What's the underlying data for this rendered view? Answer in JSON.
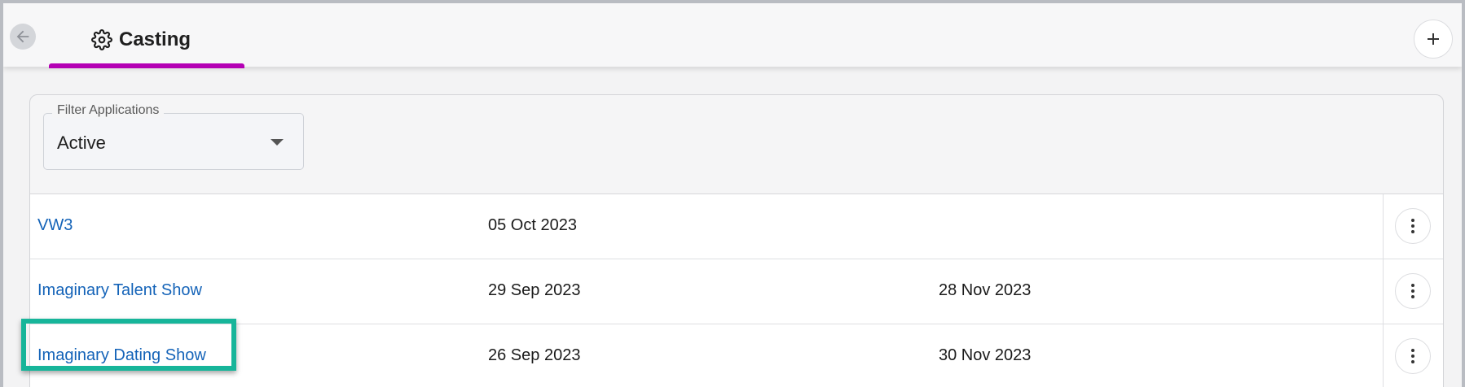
{
  "header": {
    "title": "Casting",
    "back_icon": "arrow-left-icon",
    "settings_icon": "gear-icon",
    "add_icon": "plus-icon",
    "accent_color": "#b400b4"
  },
  "filter": {
    "label": "Filter Applications",
    "value": "Active"
  },
  "rows": [
    {
      "name": "VW3",
      "date1": "05 Oct 2023",
      "date2": ""
    },
    {
      "name": "Imaginary Talent Show",
      "date1": "29 Sep 2023",
      "date2": "28 Nov 2023"
    },
    {
      "name": "Imaginary Dating Show",
      "date1": "26 Sep 2023",
      "date2": "30 Nov 2023"
    }
  ],
  "highlight": {
    "target": "Imaginary Dating Show",
    "color": "#17b59a"
  },
  "colors": {
    "link": "#1463b8"
  }
}
